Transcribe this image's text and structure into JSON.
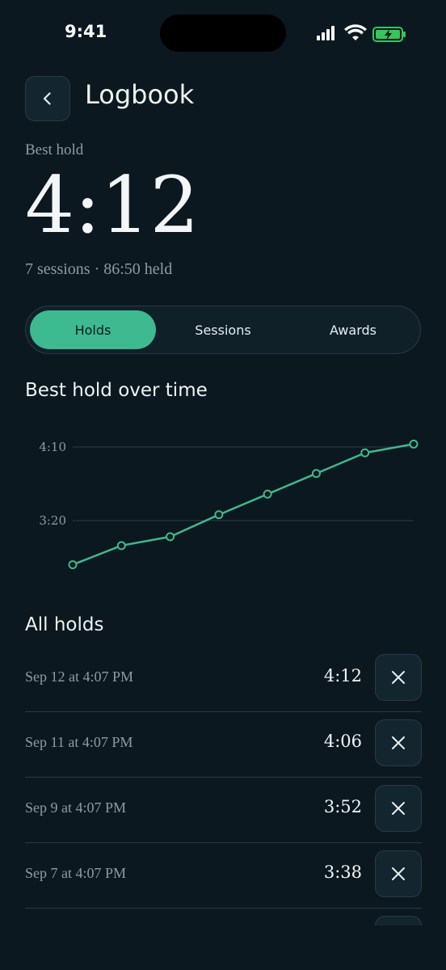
{
  "status": {
    "time": "9:41"
  },
  "header": {
    "title": "Logbook"
  },
  "best": {
    "label": "Best hold",
    "value": "4:12"
  },
  "summary": "7 sessions · 86:50 held",
  "tabs": [
    {
      "label": "Holds",
      "active": true
    },
    {
      "label": "Sessions",
      "active": false
    },
    {
      "label": "Awards",
      "active": false
    }
  ],
  "chart_section_title": "Best hold over time",
  "chart_data": {
    "type": "line",
    "title": "Best hold over time",
    "xlabel": "",
    "ylabel": "",
    "y_ticks": [
      "4:10",
      "3:20"
    ],
    "y_tick_seconds": [
      250,
      200
    ],
    "series": [
      {
        "values_seconds": [
          170,
          183,
          189,
          204,
          218,
          232,
          246,
          252
        ]
      }
    ],
    "grid": true,
    "color": "#3dba8f"
  },
  "list_section_title": "All holds",
  "holds": [
    {
      "date": "Sep 12 at 4:07 PM",
      "time": "4:12"
    },
    {
      "date": "Sep 11 at 4:07 PM",
      "time": "4:06"
    },
    {
      "date": "Sep 9 at 4:07 PM",
      "time": "3:52"
    },
    {
      "date": "Sep 7 at 4:07 PM",
      "time": "3:38"
    },
    {
      "date": "",
      "time": ""
    }
  ],
  "colors": {
    "accent": "#3dba8f",
    "background": "#0b1820",
    "battery": "#34c759"
  }
}
